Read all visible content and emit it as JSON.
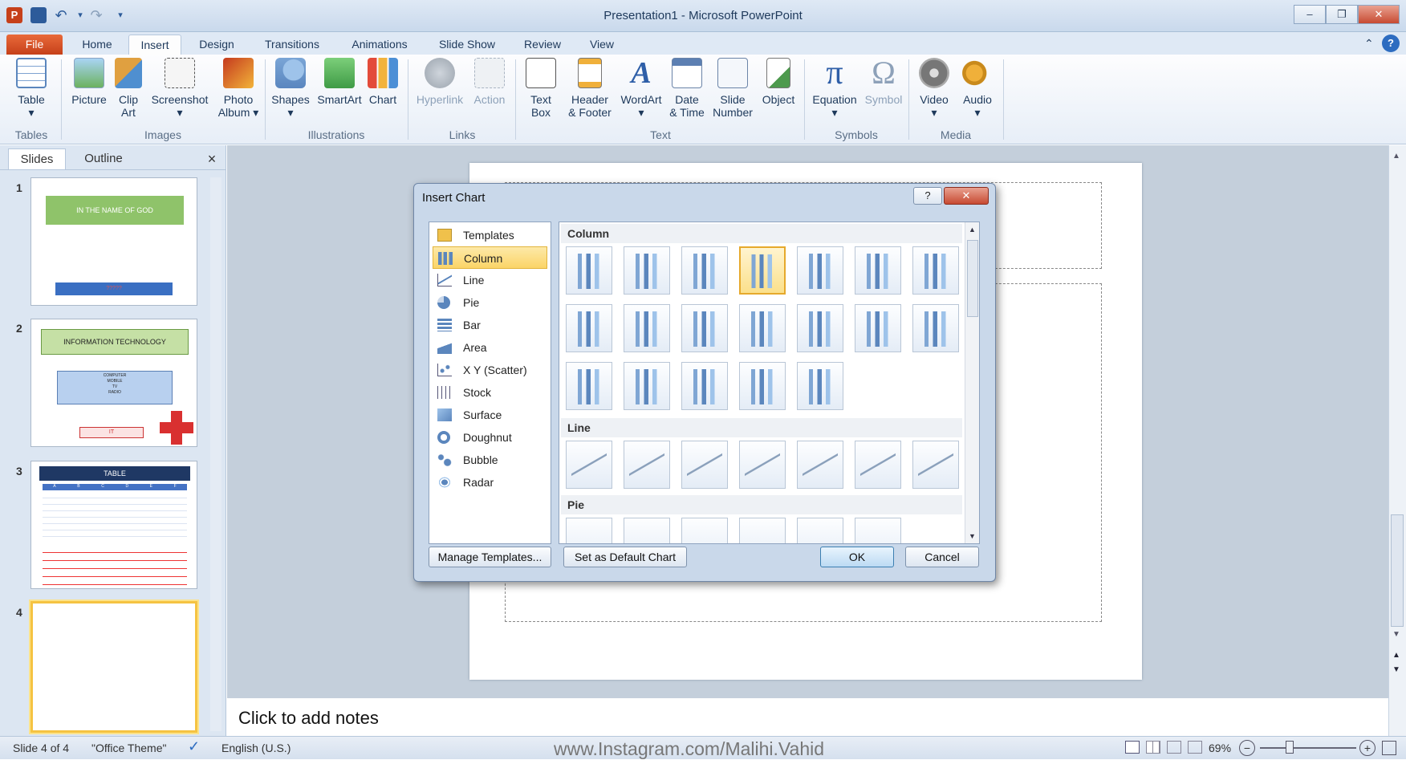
{
  "window": {
    "title": "Presentation1 - Microsoft PowerPoint",
    "controls": {
      "minimize": "–",
      "restore": "❐",
      "close": "✕"
    }
  },
  "tabs": [
    {
      "label": "File"
    },
    {
      "label": "Home"
    },
    {
      "label": "Insert",
      "active": true
    },
    {
      "label": "Design"
    },
    {
      "label": "Transitions"
    },
    {
      "label": "Animations"
    },
    {
      "label": "Slide Show"
    },
    {
      "label": "Review"
    },
    {
      "label": "View"
    }
  ],
  "ribbon": {
    "groups": [
      "Tables",
      "Images",
      "Illustrations",
      "Links",
      "Text",
      "Symbols",
      "Media"
    ],
    "buttons": {
      "table": {
        "line1": "Table",
        "line2": "▾"
      },
      "picture": {
        "line1": "Picture",
        "line2": ""
      },
      "clipart": {
        "line1": "Clip",
        "line2": "Art"
      },
      "screenshot": {
        "line1": "Screenshot",
        "line2": "▾"
      },
      "photoalbum": {
        "line1": "Photo",
        "line2": "Album ▾"
      },
      "shapes": {
        "line1": "Shapes",
        "line2": "▾"
      },
      "smartart": {
        "line1": "SmartArt",
        "line2": ""
      },
      "chart": {
        "line1": "Chart",
        "line2": ""
      },
      "hyperlink": {
        "line1": "Hyperlink",
        "line2": ""
      },
      "action": {
        "line1": "Action",
        "line2": ""
      },
      "textbox": {
        "line1": "Text",
        "line2": "Box"
      },
      "headerfooter": {
        "line1": "Header",
        "line2": "& Footer"
      },
      "wordart": {
        "line1": "WordArt",
        "line2": "▾"
      },
      "datetime": {
        "line1": "Date",
        "line2": "& Time"
      },
      "slidenumber": {
        "line1": "Slide",
        "line2": "Number"
      },
      "object": {
        "line1": "Object",
        "line2": ""
      },
      "equation": {
        "line1": "Equation",
        "line2": "▾"
      },
      "symbol": {
        "line1": "Symbol",
        "line2": ""
      },
      "video": {
        "line1": "Video",
        "line2": "▾"
      },
      "audio": {
        "line1": "Audio",
        "line2": "▾"
      }
    },
    "icons": {
      "equation": "π",
      "symbol": "Ω",
      "wordart": "A"
    }
  },
  "panel": {
    "tabs": [
      "Slides",
      "Outline"
    ],
    "close": "×",
    "slides": [
      {
        "num": "1",
        "title": "IN THE NAME OF GOD",
        "subtitle": "?????"
      },
      {
        "num": "2",
        "title": "INFORMATION TECHNOLOGY",
        "lines": [
          "COMPUTER",
          "MOBILE",
          "TV",
          "RADIO"
        ],
        "tag": "IT"
      },
      {
        "num": "3",
        "title": "TABLE",
        "cols": [
          "A",
          "B",
          "C",
          "D",
          "E",
          "F"
        ]
      },
      {
        "num": "4"
      }
    ]
  },
  "dialog": {
    "title": "Insert Chart",
    "help": "?",
    "close": "✕",
    "categories": [
      "Templates",
      "Column",
      "Line",
      "Pie",
      "Bar",
      "Area",
      "X Y (Scatter)",
      "Stock",
      "Surface",
      "Doughnut",
      "Bubble",
      "Radar"
    ],
    "selected_category": "Column",
    "sections": [
      "Column",
      "Line",
      "Pie"
    ],
    "buttons": {
      "manage": "Manage Templates...",
      "setdefault": "Set as Default Chart",
      "ok": "OK",
      "cancel": "Cancel"
    }
  },
  "notes": {
    "placeholder": "Click to add notes"
  },
  "status": {
    "slide": "Slide 4 of 4",
    "theme": "\"Office Theme\"",
    "language": "English (U.S.)",
    "watermark": "www.Instagram.com/Malihi.Vahid",
    "zoom": "69%"
  },
  "colors": {
    "accent": "#f5c342",
    "file_tab": "#d3532a",
    "thumb_green": "#8fc36a",
    "thumb_blue": "#3a6fc2"
  }
}
